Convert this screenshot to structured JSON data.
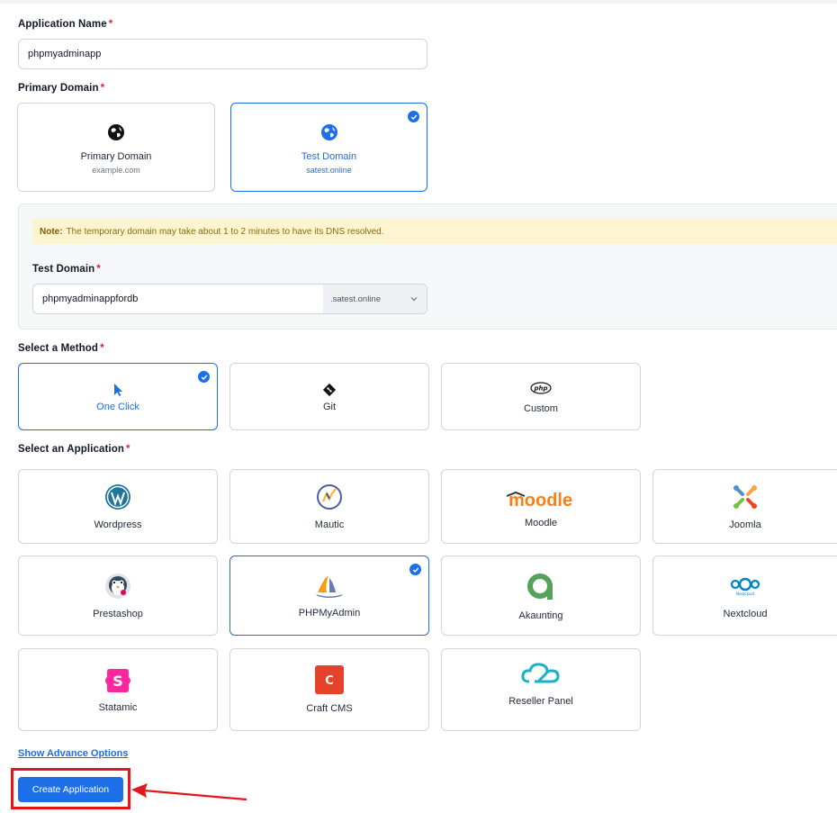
{
  "form": {
    "app_name_label": "Application Name",
    "required_mark": "*",
    "app_name_value": "phpmyadminapp",
    "primary_domain_label": "Primary Domain",
    "domain_options": [
      {
        "title": "Primary Domain",
        "subtitle": "example.com",
        "icon": "globe-icon",
        "selected": false
      },
      {
        "title": "Test Domain",
        "subtitle": "satest.online",
        "icon": "globe-icon",
        "selected": true
      }
    ],
    "note_prefix": "Note:",
    "note_text": "The temporary domain may take about 1 to 2 minutes to have its DNS resolved.",
    "test_domain_label": "Test Domain",
    "test_domain_value": "phpmyadminappfordb",
    "test_domain_suffix": ".satest.online",
    "method_label": "Select a Method",
    "methods": [
      {
        "title": "One Click",
        "icon": "cursor-icon",
        "selected": true
      },
      {
        "title": "Git",
        "icon": "git-icon",
        "selected": false
      },
      {
        "title": "Custom",
        "icon": "php-icon",
        "selected": false
      }
    ],
    "application_label": "Select an Application",
    "applications": [
      {
        "title": "Wordpress",
        "icon": "wordpress-icon"
      },
      {
        "title": "Mautic",
        "icon": "mautic-icon"
      },
      {
        "title": "Moodle",
        "icon": "moodle-logo",
        "logo_text": "moodle"
      },
      {
        "title": "Joomla",
        "icon": "joomla-icon"
      },
      {
        "title": "Prestashop",
        "icon": "prestashop-icon"
      },
      {
        "title": "PHPMyAdmin",
        "icon": "phpmyadmin-icon",
        "selected": true
      },
      {
        "title": "Akaunting",
        "icon": "akaunting-icon"
      },
      {
        "title": "Nextcloud",
        "icon": "nextcloud-icon",
        "logo_text": "Nextcloud"
      },
      {
        "title": "Statamic",
        "icon": "statamic-icon",
        "logo_text": "S"
      },
      {
        "title": "Craft CMS",
        "icon": "craft-cms-icon",
        "logo_text": "C"
      },
      {
        "title": "Reseller Panel",
        "icon": "reseller-panel-icon"
      }
    ],
    "advance_link": "Show Advance Options",
    "create_button": "Create Application"
  },
  "colors": {
    "accent": "#1d6fe8",
    "required": "#e11d48",
    "note_bg": "#fcf5cf",
    "highlight": "#e3161c"
  }
}
